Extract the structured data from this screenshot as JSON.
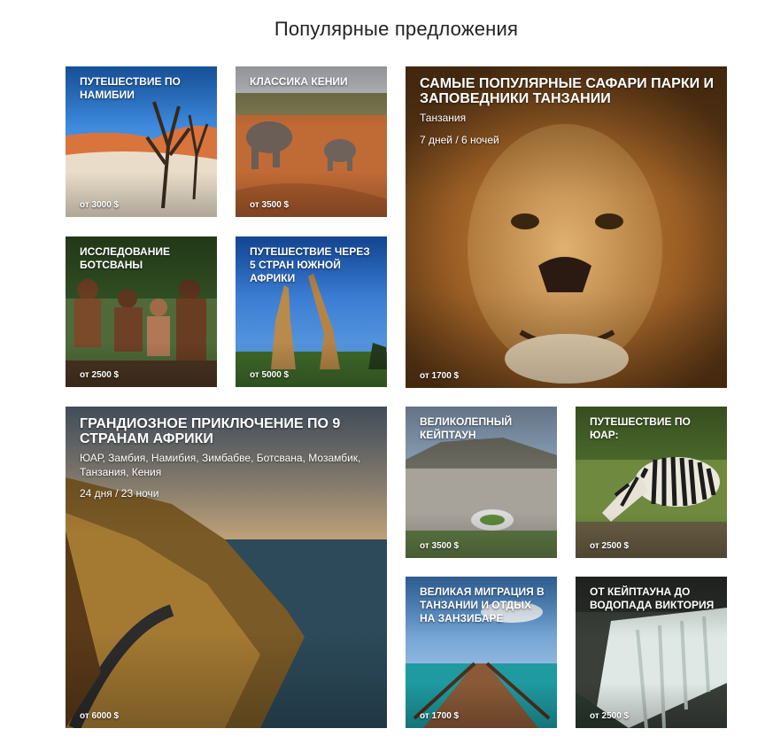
{
  "section_title": "Популярные предложения",
  "cards": [
    {
      "title": "Путешествие по Намибии",
      "price": "от 3000 $"
    },
    {
      "title": "Классика Кении",
      "price": "от 3500 $"
    },
    {
      "title": "Самые популярные сафари парки и заповедники Танзании",
      "location": "Танзания",
      "duration": "7 дней / 6 ночей",
      "price": "от 1700 $"
    },
    {
      "title": "Исследование Ботсваны",
      "price": "от 2500 $"
    },
    {
      "title": "Путешествие через 5 стран Южной Африки",
      "price": "от 5000 $"
    },
    {
      "title": "Грандиозное приключение по 9 странам Африки",
      "location": "ЮАР, Замбия, Намибия, Зимбабве, Ботсвана, Мозамбик, Танзания, Кения",
      "duration": "24 дня / 23 ночи",
      "price": "от 6000 $"
    },
    {
      "title": "Великолепный Кейптаун",
      "price": "от 3500 $"
    },
    {
      "title": "Путешествие по ЮАР:",
      "price": "от 2500 $"
    },
    {
      "title": "Великая миграция в Танзании и отдых на Занзибаре",
      "price": "от 1700 $"
    },
    {
      "title": "От Кейптауна до водопада Виктория",
      "price": "от 2500 $"
    }
  ]
}
